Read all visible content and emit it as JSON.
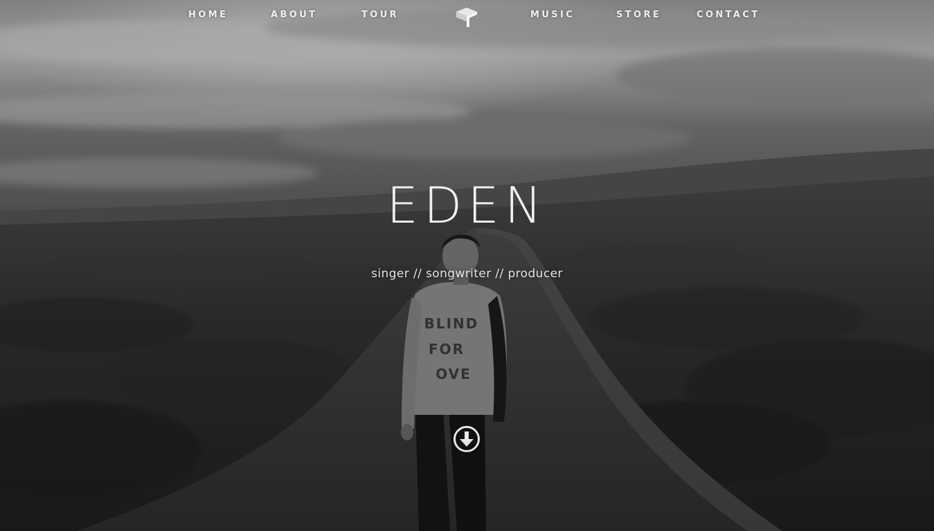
{
  "nav": {
    "items": [
      {
        "label": "HOME"
      },
      {
        "label": "ABOUT"
      },
      {
        "label": "TOUR"
      },
      {
        "label": "MUSIC"
      },
      {
        "label": "STORE"
      },
      {
        "label": "CONTACT"
      }
    ],
    "logo_icon": "eden-logo-icon"
  },
  "hero": {
    "title": "EDEN",
    "subtitle": "singer // songwriter // producer",
    "scroll_icon": "arrow-down-circle-icon",
    "background": "grayscale-landscape-photo",
    "sweater_text": [
      "BLIND",
      "FOR",
      "OVE"
    ]
  },
  "colors": {
    "text": "#f2f2f2",
    "nav_text": "#ededed"
  }
}
